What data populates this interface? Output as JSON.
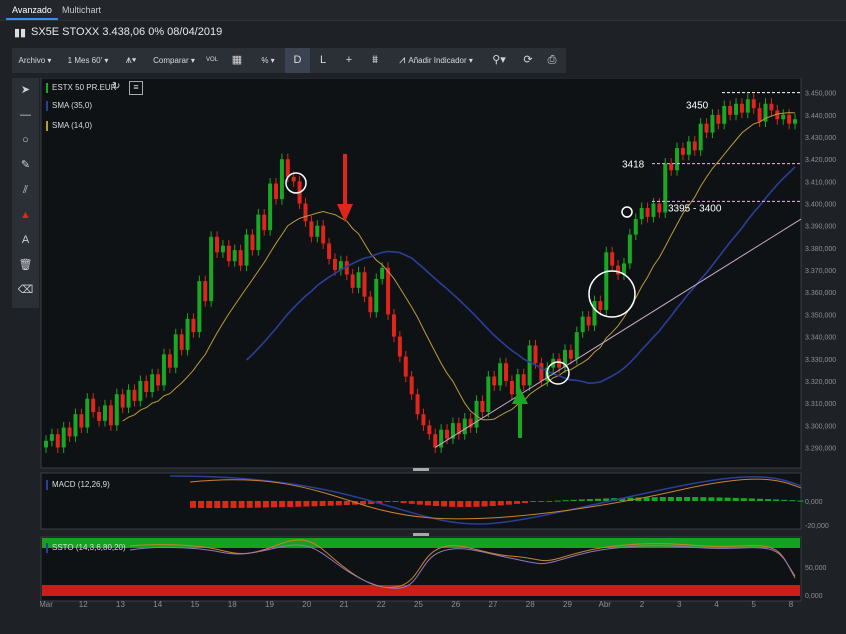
{
  "tabs": [
    {
      "label": "Avanzado",
      "active": true
    },
    {
      "label": "Multichart",
      "active": false
    }
  ],
  "title": "SX5E STOXX 3.438,06 0% 08/04/2019",
  "toolbar": {
    "archivo": "Archivo ▾",
    "period": "1 Mes 60' ▾",
    "comparar": "Comparar ▾",
    "vol": "VOL",
    "percent": "% ▾",
    "d": "D",
    "l": "L",
    "add_indicator": "Añadir Indicador ▾"
  },
  "sidebar": [
    "cursor-icon",
    "line-icon",
    "circle-icon",
    "pen-icon",
    "channel-icon",
    "marker-icon",
    "text-icon",
    "trash-icon",
    "eraser-icon"
  ],
  "main_legend": {
    "symbol": "ESTX 50 PR.EUR",
    "sma35": "SMA (35,0)",
    "sma14": "SMA (14,0)"
  },
  "macd_label": "MACD (12,26,9)",
  "ssto_label": "SSTO (14,3,6,80,20)",
  "colors": {
    "up": "#19a824",
    "down": "#e0251b",
    "sma35": "#2b3e9a",
    "sma14": "#b99a3a",
    "trend": "#c9a9c8"
  },
  "annotations": {
    "a3450": "3450",
    "a3418": "3418",
    "a3395": "3395 - 3400"
  },
  "chart_data": {
    "type": "candlestick",
    "ylim": [
      3283,
      3453
    ],
    "y_ticks": [
      "3.450,000",
      "3.440,000",
      "3.430,000",
      "3.420,000",
      "3.410,000",
      "3.400,000",
      "3.390,000",
      "3.380,000",
      "3.370,000",
      "3.360,000",
      "3.350,000",
      "3.340,000",
      "3.330,000",
      "3.320,000",
      "3.310,000",
      "3.300,000",
      "3.290,000"
    ],
    "x_labels": [
      "Mar",
      "12",
      "13",
      "14",
      "15",
      "18",
      "19",
      "20",
      "21",
      "22",
      "25",
      "26",
      "27",
      "28",
      "29",
      "Abr",
      "2",
      "3",
      "4",
      "5",
      "8"
    ],
    "closes": [
      3293,
      3296,
      3290,
      3299,
      3295,
      3305,
      3299,
      3312,
      3306,
      3302,
      3309,
      3300,
      3314,
      3308,
      3316,
      3311,
      3320,
      3315,
      3323,
      3318,
      3332,
      3326,
      3341,
      3334,
      3348,
      3342,
      3365,
      3356,
      3385,
      3378,
      3381,
      3374,
      3379,
      3372,
      3386,
      3379,
      3395,
      3388,
      3409,
      3402,
      3420,
      3412,
      3410,
      3400,
      3392,
      3385,
      3390,
      3382,
      3375,
      3370,
      3374,
      3368,
      3362,
      3369,
      3358,
      3351,
      3366,
      3371,
      3350,
      3340,
      3331,
      3322,
      3314,
      3305,
      3300,
      3296,
      3290,
      3298,
      3294,
      3301,
      3296,
      3303,
      3299,
      3311,
      3306,
      3322,
      3318,
      3328,
      3320,
      3314,
      3323,
      3318,
      3336,
      3328,
      3320,
      3326,
      3330,
      3326,
      3334,
      3330,
      3342,
      3349,
      3345,
      3356,
      3352,
      3378,
      3372,
      3368,
      3373,
      3386,
      3393,
      3398,
      3394,
      3400,
      3396,
      3418,
      3415,
      3425,
      3422,
      3428,
      3424,
      3436,
      3432,
      3440,
      3436,
      3444,
      3440,
      3445,
      3441,
      3447,
      3443,
      3437,
      3445,
      3442,
      3438,
      3440,
      3436,
      3438
    ],
    "sma35_annotation": "SMA (35,0)",
    "sma14_annotation": "SMA (14,0)"
  }
}
